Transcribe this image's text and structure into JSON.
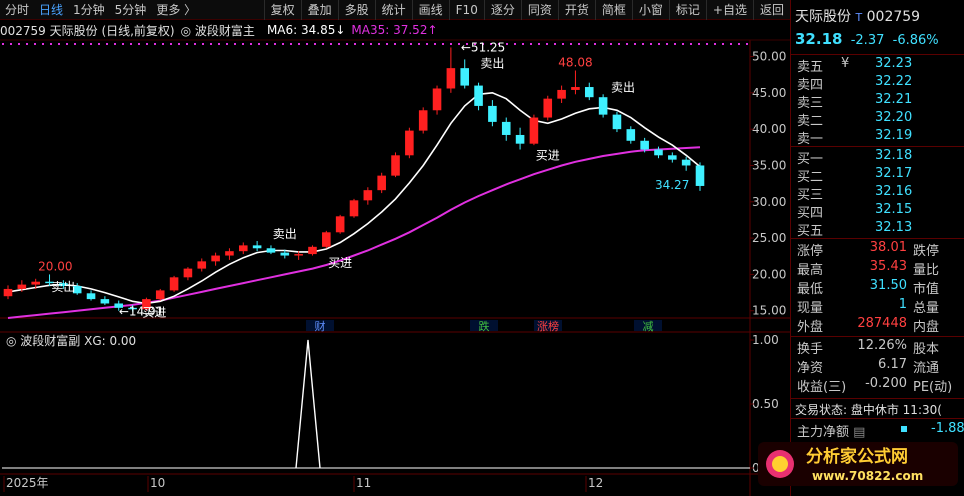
{
  "toolbar": {
    "items": [
      "分时",
      "日线",
      "1分钟",
      "5分钟",
      "更多 〉"
    ],
    "right_items": [
      "复权",
      "叠加",
      "多股",
      "统计",
      "画线",
      "F10",
      "逐分",
      "同资",
      "开货",
      "简框",
      "小窗",
      "标记",
      "+自选",
      "返回"
    ]
  },
  "info": {
    "code_name": "002759 天际股份 (日线,前复权)",
    "indicator": "波段财富主",
    "ma6": "MA6: 34.85↓",
    "ma35": "MA35: 37.52↑"
  },
  "sub_info": {
    "indicator": "波段财富副",
    "xg": "XG: 0.00"
  },
  "colors": {
    "up": "#ff2020",
    "down": "#3ff0ff",
    "ma_short": "#ffffff",
    "ma_long": "#e030e0",
    "label_red": "#ff4040",
    "label_cyan": "#40e0ff"
  },
  "price_axis": {
    "labels": [
      "50.00",
      "45.00",
      "40.00",
      "35.00",
      "30.00",
      "25.00",
      "20.00",
      "15.00"
    ]
  },
  "sub_axis": {
    "labels": [
      "1.00",
      "0.50",
      "0.00"
    ]
  },
  "x_axis": {
    "labels": [
      "2025年",
      "10",
      "11",
      "12"
    ]
  },
  "annotations": {
    "high_label": "51.25",
    "low_label": "14.91",
    "left_high": "20.00",
    "mid_high": "48.08",
    "right_low": "34.27",
    "sell": "卖出",
    "buy": "买进"
  },
  "events": [
    "财",
    "跌",
    "涨榜",
    "减"
  ],
  "quote": {
    "name": "天际股份",
    "code": "002759",
    "price": "32.18",
    "change": "-2.37",
    "pct": "-6.86%",
    "asks": [
      {
        "label": "卖五",
        "price": "32.23"
      },
      {
        "label": "卖四",
        "price": "32.22"
      },
      {
        "label": "卖三",
        "price": "32.21"
      },
      {
        "label": "卖二",
        "price": "32.20"
      },
      {
        "label": "卖一",
        "price": "32.19"
      }
    ],
    "bids": [
      {
        "label": "买一",
        "price": "32.18"
      },
      {
        "label": "买二",
        "price": "32.17"
      },
      {
        "label": "买三",
        "price": "32.16"
      },
      {
        "label": "买四",
        "price": "32.15"
      },
      {
        "label": "买五",
        "price": "32.13"
      }
    ],
    "stats": [
      {
        "label": "涨停",
        "value": "38.01",
        "label2": "跌停"
      },
      {
        "label": "最高",
        "value": "35.43",
        "label2": "量比"
      },
      {
        "label": "最低",
        "value": "31.50",
        "label2": "市值"
      },
      {
        "label": "现量",
        "value": "1",
        "label2": "总量"
      },
      {
        "label": "外盘",
        "value": "287448",
        "label2": "内盘"
      }
    ],
    "stats2": [
      {
        "label": "换手",
        "value": "12.26%",
        "label2": "股本"
      },
      {
        "label": "净资",
        "value": "6.17",
        "label2": "流通"
      },
      {
        "label": "收益(三)",
        "value": "-0.200",
        "label2": "PE(动)"
      }
    ],
    "status": "交易状态: 盘中休市 11:30(",
    "main_flow_label": "主力净额",
    "main_flow_value": "-1.88"
  },
  "logo": {
    "text": "分析家公式网",
    "url": "www.70822.com"
  },
  "chart_data": {
    "type": "candlestick",
    "ylim": [
      14,
      52
    ],
    "x": [
      "2025-09",
      "2025-10",
      "2025-11",
      "2025-12"
    ],
    "ohlc": [
      [
        17.0,
        18.5,
        16.6,
        18.0
      ],
      [
        18.0,
        19.2,
        17.6,
        18.6
      ],
      [
        18.6,
        19.4,
        18.0,
        19.0
      ],
      [
        19.0,
        20.0,
        18.4,
        18.8
      ],
      [
        18.8,
        19.2,
        18.0,
        18.4
      ],
      [
        18.4,
        18.8,
        17.2,
        17.4
      ],
      [
        17.4,
        17.8,
        16.4,
        16.6
      ],
      [
        16.6,
        17.0,
        15.8,
        16.0
      ],
      [
        16.0,
        16.4,
        15.0,
        15.4
      ],
      [
        15.4,
        15.8,
        14.9,
        15.2
      ],
      [
        15.2,
        16.8,
        15.0,
        16.6
      ],
      [
        16.6,
        18.0,
        16.4,
        17.8
      ],
      [
        17.8,
        19.8,
        17.6,
        19.6
      ],
      [
        19.6,
        21.0,
        19.2,
        20.8
      ],
      [
        20.8,
        22.2,
        20.4,
        21.8
      ],
      [
        21.8,
        23.0,
        21.2,
        22.6
      ],
      [
        22.6,
        23.6,
        22.0,
        23.2
      ],
      [
        23.2,
        24.4,
        22.8,
        24.0
      ],
      [
        24.0,
        24.6,
        23.2,
        23.6
      ],
      [
        23.6,
        24.0,
        22.8,
        23.0
      ],
      [
        23.0,
        23.4,
        22.2,
        22.6
      ],
      [
        22.6,
        23.2,
        22.0,
        22.8
      ],
      [
        22.8,
        24.0,
        22.6,
        23.8
      ],
      [
        23.8,
        26.0,
        23.6,
        25.8
      ],
      [
        25.8,
        28.2,
        25.6,
        28.0
      ],
      [
        28.0,
        30.4,
        27.8,
        30.2
      ],
      [
        30.2,
        32.0,
        29.6,
        31.6
      ],
      [
        31.6,
        34.0,
        31.2,
        33.6
      ],
      [
        33.6,
        36.8,
        33.4,
        36.4
      ],
      [
        36.4,
        40.2,
        36.0,
        39.8
      ],
      [
        39.8,
        43.0,
        39.4,
        42.6
      ],
      [
        42.6,
        46.0,
        42.0,
        45.6
      ],
      [
        45.6,
        51.25,
        45.0,
        48.4
      ],
      [
        48.4,
        49.6,
        45.6,
        46.0
      ],
      [
        46.0,
        46.4,
        42.6,
        43.2
      ],
      [
        43.2,
        44.0,
        40.4,
        41.0
      ],
      [
        41.0,
        41.6,
        38.4,
        39.2
      ],
      [
        39.2,
        40.2,
        37.2,
        38.0
      ],
      [
        38.0,
        42.0,
        37.8,
        41.6
      ],
      [
        41.6,
        44.6,
        41.2,
        44.2
      ],
      [
        44.2,
        46.0,
        43.6,
        45.4
      ],
      [
        45.4,
        48.08,
        44.8,
        45.8
      ],
      [
        45.8,
        46.4,
        44.0,
        44.4
      ],
      [
        44.4,
        44.8,
        41.6,
        42.0
      ],
      [
        42.0,
        42.4,
        39.6,
        40.0
      ],
      [
        40.0,
        40.4,
        38.0,
        38.4
      ],
      [
        38.4,
        38.8,
        36.8,
        37.2
      ],
      [
        37.2,
        37.6,
        36.0,
        36.4
      ],
      [
        36.4,
        36.8,
        35.4,
        35.8
      ],
      [
        35.8,
        36.2,
        34.27,
        35.0
      ],
      [
        35.0,
        35.43,
        31.5,
        32.18
      ]
    ],
    "ma6": [
      17.6,
      17.9,
      18.2,
      18.5,
      18.6,
      18.4,
      18.0,
      17.5,
      16.9,
      16.3,
      16.0,
      16.3,
      17.0,
      18.0,
      19.1,
      20.3,
      21.4,
      22.3,
      23.0,
      23.3,
      23.3,
      23.1,
      23.1,
      23.5,
      24.4,
      25.6,
      27.0,
      28.6,
      30.4,
      32.6,
      35.0,
      37.8,
      40.8,
      43.2,
      44.8,
      45.0,
      44.2,
      42.6,
      41.2,
      40.8,
      41.4,
      42.2,
      42.8,
      43.0,
      42.6,
      41.6,
      40.2,
      38.9,
      37.8,
      36.4,
      34.85
    ],
    "ma35": [
      14.0,
      14.2,
      14.4,
      14.6,
      14.8,
      15.0,
      15.2,
      15.4,
      15.6,
      15.8,
      16.1,
      16.4,
      16.8,
      17.2,
      17.6,
      18.0,
      18.4,
      18.8,
      19.2,
      19.6,
      20.0,
      20.4,
      20.8,
      21.3,
      21.9,
      22.6,
      23.3,
      24.1,
      24.9,
      25.8,
      26.8,
      27.8,
      28.9,
      29.9,
      30.8,
      31.6,
      32.4,
      33.1,
      33.8,
      34.4,
      35.0,
      35.5,
      35.9,
      36.3,
      36.6,
      36.9,
      37.1,
      37.2,
      37.3,
      37.4,
      37.52
    ],
    "xg": [
      0,
      0,
      0,
      0,
      0,
      0,
      0,
      0,
      0,
      0,
      0,
      0,
      0,
      0,
      0,
      0,
      0,
      0,
      0,
      0,
      0,
      0,
      0,
      0,
      0,
      0,
      0,
      0,
      0,
      0,
      0,
      0,
      0,
      0,
      0,
      0,
      0,
      0,
      0,
      0,
      0,
      0,
      0,
      0,
      0,
      0,
      0,
      0,
      0,
      0,
      0
    ],
    "xg_spike": 1.0
  }
}
